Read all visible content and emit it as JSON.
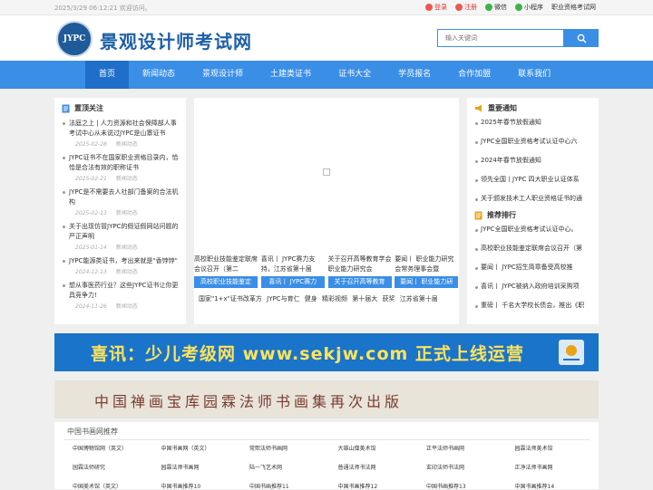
{
  "topbar": {
    "datetime": "2025/3/29 06:12:21",
    "welcome": "欢迎访问。",
    "login": "登录",
    "register": "注册",
    "wechat": "微信",
    "miniprogram": "小程序",
    "site_label": "职业资格考试网"
  },
  "header": {
    "logo_text": "JYPC",
    "site_name": "景观设计师考试网",
    "search_placeholder": "输入关键词"
  },
  "nav": [
    "首页",
    "新闻动态",
    "景观设计师",
    "土建类证书",
    "证书大全",
    "学员报名",
    "合作加盟",
    "联系我们"
  ],
  "left": {
    "title": "置顶关注",
    "items": [
      {
        "title": "法庭之上 | 人力资源和社会保障部人事考试中心从未说过JYPC是山寨证书",
        "date": "2025-02-28",
        "tag": "新闻动态"
      },
      {
        "title": "JYPC证书不在国家职业资格目录内，恰恰是合法有效的职称证书",
        "date": "2025-02-21",
        "tag": "新闻动态"
      },
      {
        "title": "JYPC是不需要去人社部门备案的合法机构",
        "date": "2025-02-13",
        "tag": "新闻动态"
      },
      {
        "title": "关于出现仿冒JYPC的假证假网站问题的严正声明",
        "date": "2025-01-14",
        "tag": "新闻动态"
      },
      {
        "title": "JYPC能源类证书，考出来就是\"香饽饽\"",
        "date": "2024-12-13",
        "tag": "新闻动态"
      },
      {
        "title": "想从事医药行业？这些JYPC证书让你更具竞争力!",
        "date": "2024-11-26",
        "tag": "新闻动态"
      }
    ]
  },
  "center": {
    "thumbs": [
      {
        "caption": "高校职业技能鉴定联席会议召开（第二",
        "label": "高校职业技能鉴定"
      },
      {
        "caption": "喜讯丨 JYPC赛力支持，江苏省第十届",
        "label": "喜讯丨 JYPC赛力"
      },
      {
        "caption": "关于召开高等教育学会职业能力研究会",
        "label": "关于召开高等教育"
      },
      {
        "caption": "要闻丨 职业能力研究会常务理事会暨",
        "label": "要闻丨 职业能力研"
      }
    ],
    "ticker": "国家\"1+x\"证书改革方 JYPC与育仁 健身 精彩视频 第十届大 获奖 江苏省第十届"
  },
  "right": {
    "notice_title": "重要通知",
    "notices": [
      "2025年春节放假通知",
      "JYPC全国职业资格考试认证中心六",
      "2024年春节放假通知",
      "领先全国丨JYPC 四大职业认证体系",
      "关于颁发技术工人职业资格证书的通"
    ],
    "rank_title": "推荐排行",
    "ranks": [
      "JYPC全国职业资格考试认证中心。",
      "高校职业技能鉴定联席会议召开（第",
      "要闻丨 JYPC招生简章备受高校推",
      "喜讯丨 JYPC被纳入政府培训采购项",
      "重磅丨 千名大学校长债会，推出《职"
    ]
  },
  "banner1": {
    "text": "喜讯：少儿考级网 www.sekjw.com 正式上线运营"
  },
  "banner2": {
    "text": "中国禅画宝库园霖法师书画集再次出版"
  },
  "friend_links": {
    "title": "中国书画网推荐",
    "items": [
      "中国博物馆网（英文）",
      "中国书画网（英文）",
      "常熙法师书画网",
      "大雄山僧美术馆",
      "正平法师书画网",
      "园霖法师美术馆",
      "园霖法师研究",
      "园霖法师书画网",
      "陆一飞艺术网",
      "普通法师书法网",
      "玄印法师书法网",
      "正净法师书画网",
      "中国美术馆（英文）",
      "中国书画推荐10",
      "中国书画推荐11",
      "中国书画推荐12",
      "中国书画推荐13",
      "中国书画推荐14"
    ]
  },
  "colors": {
    "primary": "#3a8ee6",
    "nav_active": "#1f6fca",
    "title": "#1e5fa8"
  }
}
